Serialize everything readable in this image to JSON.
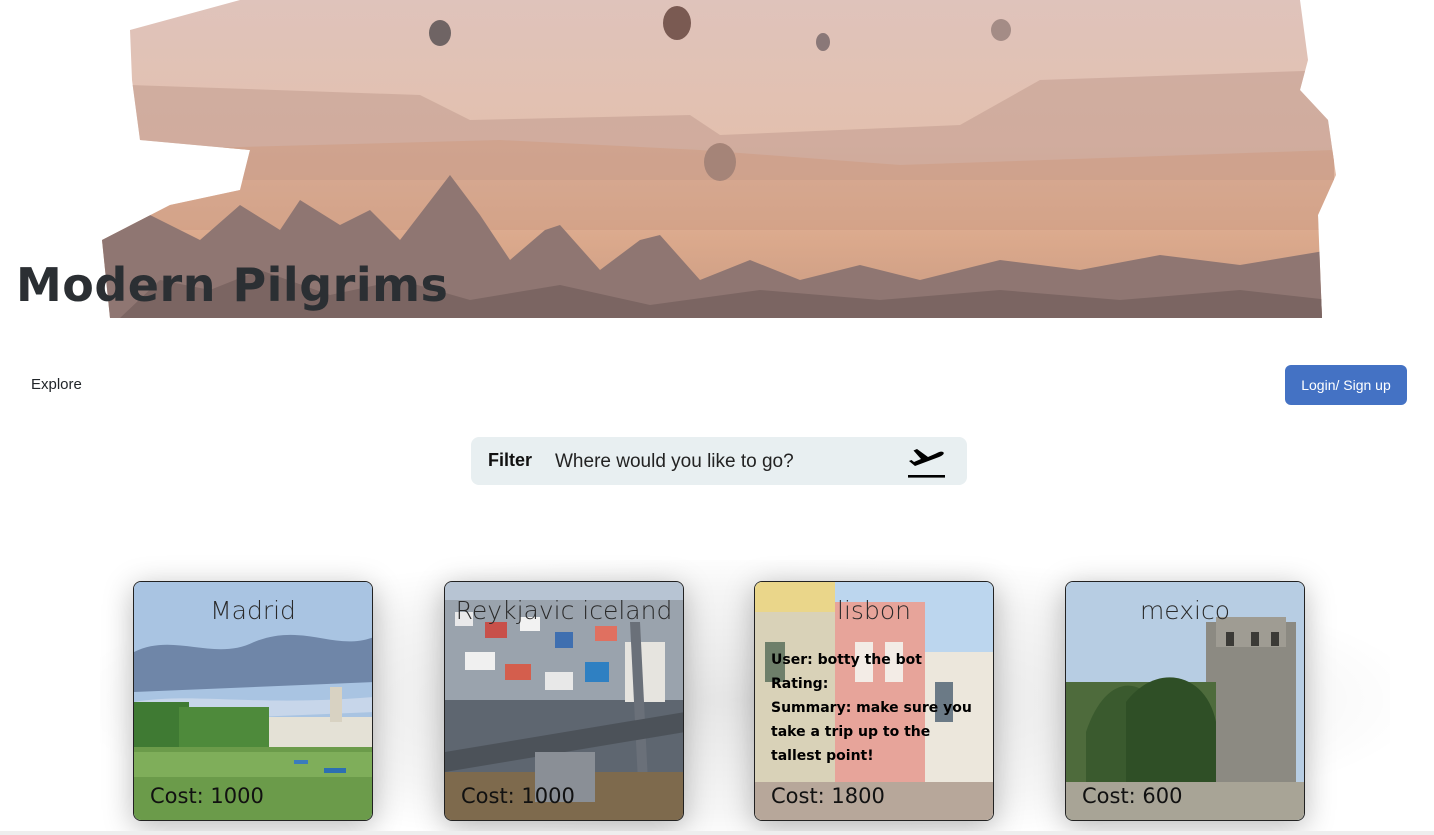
{
  "site": {
    "title": "Modern Pilgrims"
  },
  "nav": {
    "explore_label": "Explore",
    "login_label": "Login/ Sign up"
  },
  "filter": {
    "label": "Filter",
    "placeholder": "Where would you like to go?",
    "icon": "airplane-takeoff-icon"
  },
  "colors": {
    "button": "#4472c4",
    "filter_bg": "#e8eff1"
  },
  "cards": [
    {
      "title": "Madrid",
      "cost": "Cost: 1000"
    },
    {
      "title": "Reykjavic iceland",
      "cost": "Cost: 1000"
    },
    {
      "title": "lisbon",
      "cost": "Cost: 1800",
      "review": {
        "user": "User: botty the bot",
        "rating": "Rating:",
        "summary_lines": [
          "Summary: make sure you",
          "take a trip up to the",
          "tallest point!"
        ]
      }
    },
    {
      "title": "mexico",
      "cost": "Cost: 600"
    }
  ]
}
